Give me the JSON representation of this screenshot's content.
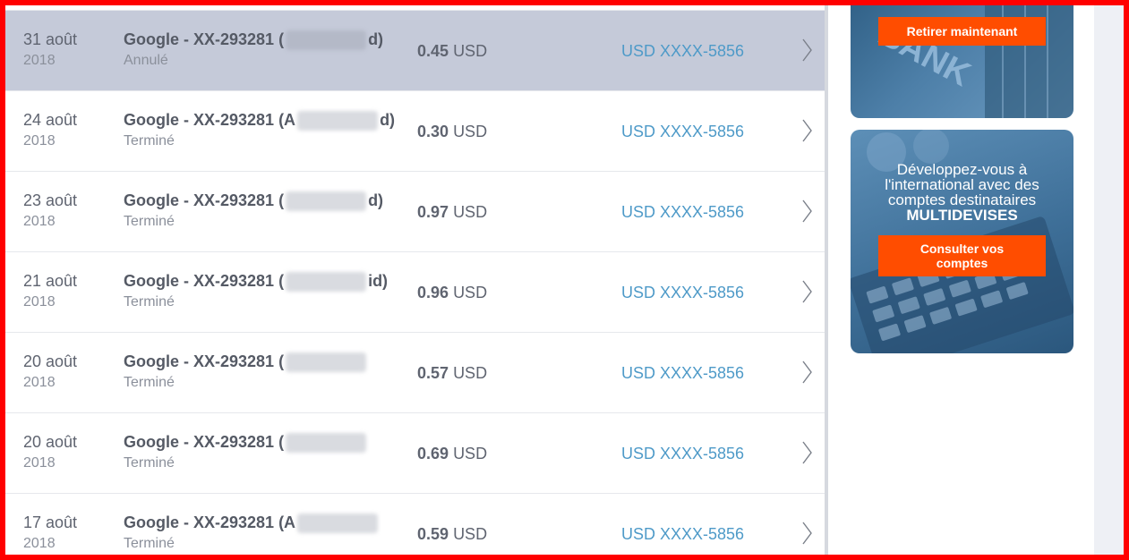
{
  "transactions": [
    {
      "date": "31 août",
      "year": "2018",
      "desc": "Google - XX-293281 (",
      "desc_end": "d)",
      "status": "Annulé",
      "amount": "0.45",
      "currency": "USD",
      "account": "USD XXXX-5856",
      "selected": true
    },
    {
      "date": "24 août",
      "year": "2018",
      "desc": "Google - XX-293281 (A",
      "desc_end": "d)",
      "status": "Terminé",
      "amount": "0.30",
      "currency": "USD",
      "account": "USD XXXX-5856"
    },
    {
      "date": "23 août",
      "year": "2018",
      "desc": "Google - XX-293281 (",
      "desc_end": "d)",
      "status": "Terminé",
      "amount": "0.97",
      "currency": "USD",
      "account": "USD XXXX-5856"
    },
    {
      "date": "21 août",
      "year": "2018",
      "desc": "Google - XX-293281 (",
      "desc_end": "id)",
      "status": "Terminé",
      "amount": "0.96",
      "currency": "USD",
      "account": "USD XXXX-5856"
    },
    {
      "date": "20 août",
      "year": "2018",
      "desc": "Google - XX-293281 (",
      "desc_end": "",
      "status": "Terminé",
      "amount": "0.57",
      "currency": "USD",
      "account": "USD XXXX-5856"
    },
    {
      "date": "20 août",
      "year": "2018",
      "desc": "Google - XX-293281 (",
      "desc_end": "",
      "status": "Terminé",
      "amount": "0.69",
      "currency": "USD",
      "account": "USD XXXX-5856"
    },
    {
      "date": "17 août",
      "year": "2018",
      "desc": "Google - XX-293281 (A",
      "desc_end": "",
      "status": "Terminé",
      "amount": "0.59",
      "currency": "USD",
      "account": "USD XXXX-5856"
    }
  ],
  "sidebar": {
    "withdraw_button": "Retirer maintenant",
    "bank_graphic_label": "BANK",
    "promo_lines": [
      "Développez-vous à",
      "l'international avec des",
      "comptes destinataires"
    ],
    "promo_strong": "MULTIDEVISES",
    "accounts_button_line1": "Consulter vos",
    "accounts_button_line2": "comptes"
  },
  "colors": {
    "frame": "#ff0000",
    "selected_row": "#c5cad9",
    "account_link": "#4e9ac8",
    "orange_button": "#ff4d00"
  }
}
